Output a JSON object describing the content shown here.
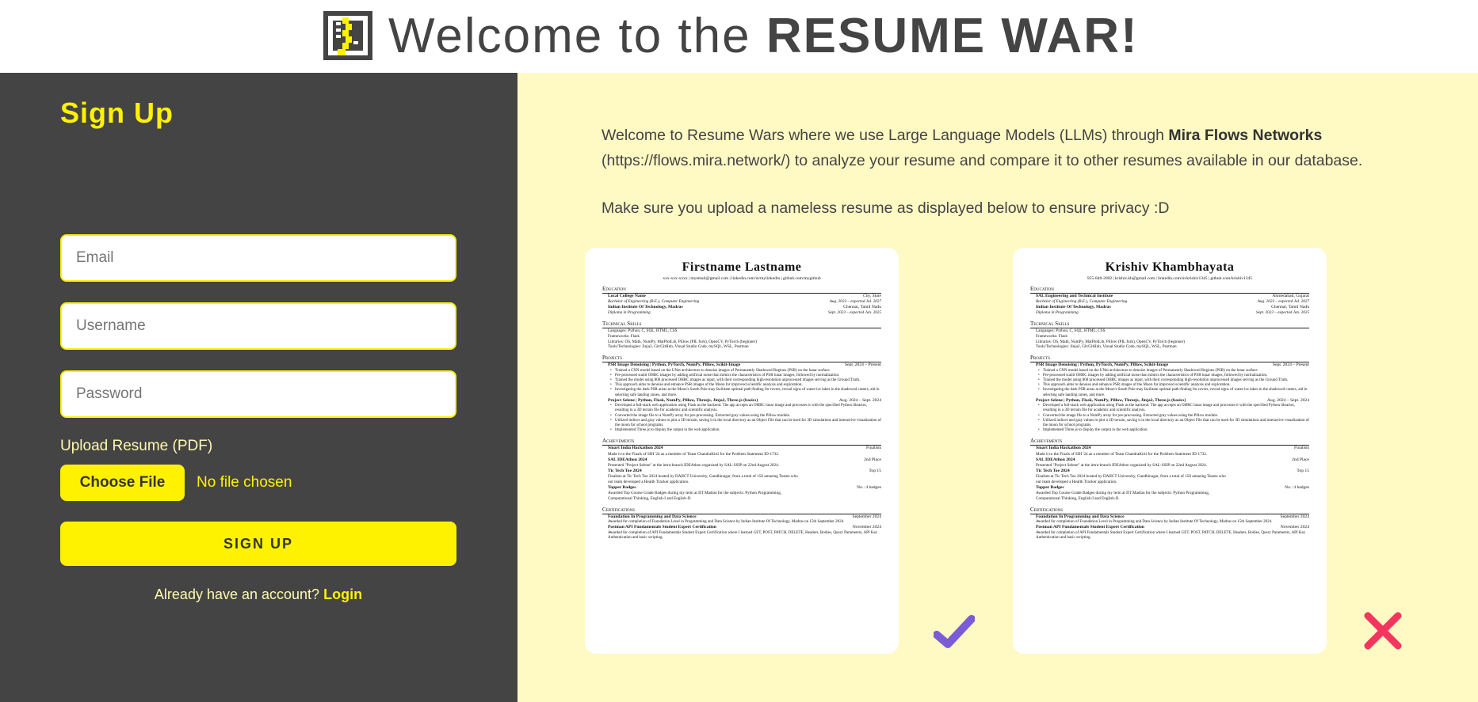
{
  "header": {
    "title_prefix": "Welcome to the ",
    "title_bold": "RESUME WAR!",
    "logo_icon": "resume-document-icon"
  },
  "signup": {
    "title": "Sign Up",
    "email_placeholder": "Email",
    "username_placeholder": "Username",
    "password_placeholder": "Password",
    "upload_label": "Upload Resume (PDF)",
    "choose_file_label": "Choose File",
    "no_file_text": "No file chosen",
    "submit_label": "SIGN UP",
    "login_prompt": "Already have an account?",
    "login_link": "Login"
  },
  "intro": {
    "text_before": "Welcome to Resume Wars where we use Large Language Models (LLMs) through ",
    "brand": "Mira Flows Networks",
    "text_after": " (https://flows.mira.network/) to analyze your resume and compare it to other resumes available in our database.",
    "privacy": "Make sure you upload a nameless resume as displayed below to ensure privacy :D"
  },
  "examples": {
    "good": {
      "name": "Firstname Lastname",
      "contact": "xxx-xxx-xxxx | myemail@gmail.com | linkedin.com/in/mylinkedin | github.com/mygithub",
      "college": "Local College Name",
      "college_loc": "City, State",
      "indicator_icon": "checkmark-icon"
    },
    "bad": {
      "name": "Krishiv Khambhayata",
      "contact": "955-848-2002 | krishiv.kh@gmail.com | linkedin.com/in/krishiv1345 | github.com/krishiv1345",
      "college": "SAL Engineering and Technical Institute",
      "college_loc": "Ahmedabad, Gujarat",
      "indicator_icon": "cross-icon"
    }
  },
  "resume_common": {
    "education": "Education",
    "degree": "Bachelor of Engineering (B.E.), Computer Engineering",
    "degree_dates": "Aug. 2023 – expected Jul. 2027",
    "iit": "Indian Institute Of Technology, Madras",
    "iit_loc": "Chennai, Tamil Nadu",
    "iit_degree": "Diploma in Programming",
    "iit_dates": "Sept. 2023 – expected Jan. 2025",
    "skills": "Technical Skills",
    "skill_lines": [
      "Languages: Python, C, SQL, HTML, CSS",
      "Frameworks: Flask",
      "Libraries: OS, Math, NumPy, MatPlotLib, Pillow (PIL fork), OpenCV, PyTorch (beginner)",
      "Tools/Technologies: Jinja2, Git/GitHub, Visual Studio Code, mySQL, WSL, Postman"
    ],
    "projects": "Projects",
    "proj1": "PSR Image Denoising | Python, PyTorch, NumPy, Pillow, Scikit-Image",
    "proj1_dates": "Sept. 2024 – Present",
    "proj1_bullets": [
      "Trained a CNN model based on the UNet architecture to denoise images of Permanently Shadowed Regions (PSR) on the lunar surface.",
      "Pre-processed sunlit OHRC images by adding artificial noise that mimics the characteristics of PSR lunar images, followed by normalization.",
      "Trained the model using 800 processed OHRC images as input, with their corresponding high-resolution unprocessed images serving as the Ground Truth.",
      "This approach aims to denoise and enhance PSR images of the Moon for improved scientific analysis and exploration.",
      "Investigating the dark PSR areas at the Moon's South Pole may facilitate optimal path-finding for rovers, reveal signs of water-ice lakes in the shadowed craters, aid in selecting safe landing zones, and more."
    ],
    "proj2": "Project Selene | Python, Flask, NumPy, Pillow, Threejs, Jinja2, Three.js (basics)",
    "proj2_dates": "Aug. 2024 – Sept. 2024",
    "proj2_bullets": [
      "Developed a full-stack web application using Flask as the backend. The app accepts an OHRC lunar image and processes it with the specified Python libraries, resulting in a 3D terrain file for academic and scientific analysis.",
      "Converted the image file to a NumPy array for pre-processing. Extracted gray values using the Pillow module.",
      "Utilized indices and gray values to plot a 3D terrain, saving it in the local directory as an Object File that can be used for 3D simulations and interactive visualization of the moon for school programs.",
      "Implemented Three.js to display the output in the web application."
    ],
    "achievements": "Achievements",
    "ach_lines": [
      [
        "Smart India Hackathon 2024",
        "Finalists"
      ],
      [
        "Made it to the Finals of SIH '24 as a member of Team ChandraKirti for the Problem Statement ID-1732.",
        ""
      ],
      [
        "SAL IDEAthon 2024",
        "2nd Place"
      ],
      [
        "Presented \"Project Selene\" at the intra-branch IDEAthon organized by SAL-SSIP on 22nd August 2024.",
        ""
      ],
      [
        "Tic Tech Toe 2024",
        "Top 15"
      ],
      [
        "Finalists at Tic Tech Toe 2024 hosted by DAIICT University, Gandhinagar, from a total of 150 amazing Teams who",
        ""
      ],
      [
        "our team developed a Health Tracker application.",
        ""
      ],
      [
        "Topper Badges",
        "No.: 4 badges"
      ],
      [
        "Awarded Top Course Grade Badges during my term at IIT Madras for the subjects: Python Programming,",
        ""
      ],
      [
        "Computational Thinking, English-I and English-II.",
        ""
      ]
    ],
    "certifications": "Certifications",
    "cert_lines": [
      [
        "Foundation In Programming and Data Science",
        "September 2024"
      ],
      [
        "Awarded for completion of Foundation Level in Programming and Data Science by Indian Institute Of Technology, Madras on 15th September 2024.",
        ""
      ],
      [
        "Postman API Fundamentals Student Expert Certification",
        "November 2024"
      ],
      [
        "Awarded for completion of API Fundamentals Student Expert Certification where I learned GET, POST, PATCH, DELETE, Headers, Bodies, Query Parameters, API Key Authentication and basic scripting.",
        ""
      ]
    ]
  },
  "colors": {
    "accent": "#fff200",
    "dark_panel": "#444444",
    "light_panel": "#fff9c4",
    "check": "#7b5cd6",
    "cross": "#f2365e"
  }
}
